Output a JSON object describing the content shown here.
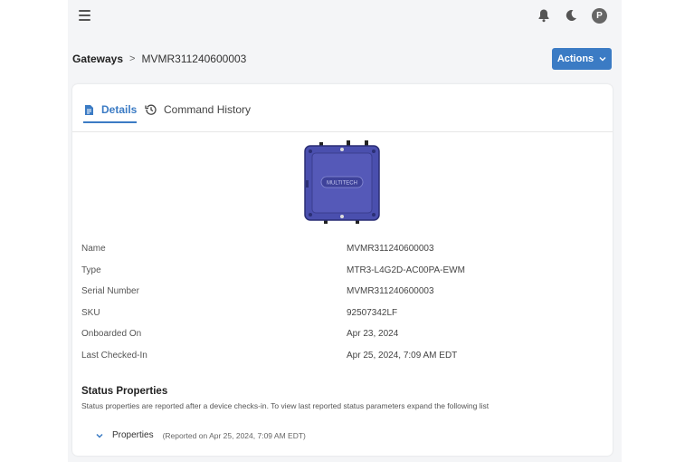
{
  "header": {
    "avatar_initial": "P",
    "icons": [
      "menu-icon",
      "bell-icon",
      "moon-icon"
    ]
  },
  "breadcrumb": {
    "parent": "Gateways",
    "separator": ">",
    "current": "MVMR311240600003"
  },
  "actions_button": {
    "label": "Actions"
  },
  "tabs": [
    {
      "label": "Details",
      "active": true
    },
    {
      "label": "Command History",
      "active": false
    }
  ],
  "device_image": {
    "brand_text": "MULTITECH"
  },
  "properties": [
    {
      "label": "Name",
      "value": "MVMR311240600003"
    },
    {
      "label": "Type",
      "value": "MTR3-L4G2D-AC00PA-EWM"
    },
    {
      "label": "Serial Number",
      "value": "MVMR311240600003"
    },
    {
      "label": "SKU",
      "value": "92507342LF"
    },
    {
      "label": "Onboarded On",
      "value": "Apr 23, 2024"
    },
    {
      "label": "Last Checked-In",
      "value": "Apr 25, 2024, 7:09 AM EDT"
    }
  ],
  "status": {
    "title": "Status Properties",
    "description": "Status properties are reported after a device checks-in. To view last reported status parameters expand the following list",
    "properties_label": "Properties",
    "reported": "(Reported on Apr 25, 2024, 7:09 AM EDT)"
  },
  "colors": {
    "accent": "#3b7bc4",
    "device": "#4a4fae"
  }
}
